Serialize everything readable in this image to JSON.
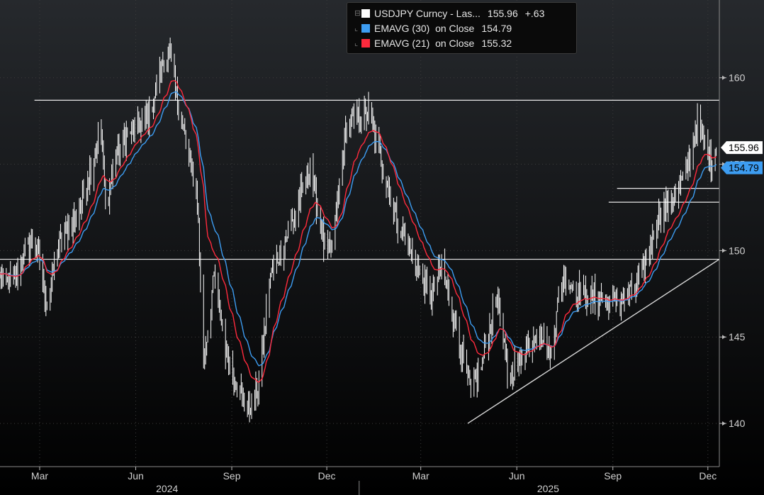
{
  "chart_data": {
    "type": "line",
    "title": "",
    "ylim": [
      137.5,
      164.5
    ],
    "y_ticks": [
      140,
      145,
      150,
      155,
      160
    ],
    "x_range": [
      "2024-01-23",
      "2025-12-12"
    ],
    "x_month_ticks": [
      {
        "label": "Mar",
        "date": "2024-03-01"
      },
      {
        "label": "Jun",
        "date": "2024-06-01"
      },
      {
        "label": "Sep",
        "date": "2024-09-01"
      },
      {
        "label": "Dec",
        "date": "2024-12-01"
      },
      {
        "label": "Mar",
        "date": "2025-03-01"
      },
      {
        "label": "Jun",
        "date": "2025-06-01"
      },
      {
        "label": "Sep",
        "date": "2025-09-01"
      },
      {
        "label": "Dec",
        "date": "2025-12-01"
      }
    ],
    "x_year_labels": [
      {
        "label": "2024",
        "date": "2024-07-01"
      },
      {
        "label": "2025",
        "date": "2025-07-01"
      }
    ],
    "series": [
      {
        "name": "USDJPY Curncy - Las...",
        "style": "hl-bars",
        "color": "#ffffff",
        "last": "155.96",
        "change": "+.63",
        "points": [
          [
            "2024-01-23",
            148.5
          ],
          [
            "2024-02-05",
            148.0
          ],
          [
            "2024-02-15",
            150.0
          ],
          [
            "2024-02-26",
            150.5
          ],
          [
            "2024-03-08",
            146.9
          ],
          [
            "2024-03-19",
            150.4
          ],
          [
            "2024-03-29",
            151.3
          ],
          [
            "2024-04-10",
            152.8
          ],
          [
            "2024-04-18",
            154.6
          ],
          [
            "2024-04-29",
            157.0
          ],
          [
            "2024-05-03",
            152.5
          ],
          [
            "2024-05-14",
            155.8
          ],
          [
            "2024-05-28",
            157.0
          ],
          [
            "2024-06-14",
            157.8
          ],
          [
            "2024-06-27",
            160.8
          ],
          [
            "2024-07-03",
            161.6
          ],
          [
            "2024-07-11",
            158.5
          ],
          [
            "2024-07-18",
            156.5
          ],
          [
            "2024-07-30",
            153.0
          ],
          [
            "2024-08-05",
            143.5
          ],
          [
            "2024-08-15",
            148.5
          ],
          [
            "2024-08-26",
            144.3
          ],
          [
            "2024-09-05",
            142.5
          ],
          [
            "2024-09-16",
            140.7
          ],
          [
            "2024-09-27",
            142.2
          ],
          [
            "2024-10-07",
            148.3
          ],
          [
            "2024-10-18",
            150.0
          ],
          [
            "2024-10-31",
            152.0
          ],
          [
            "2024-11-15",
            155.0
          ],
          [
            "2024-11-29",
            150.0
          ],
          [
            "2024-12-06",
            150.0
          ],
          [
            "2024-12-20",
            157.3
          ],
          [
            "2025-01-10",
            158.0
          ],
          [
            "2025-01-21",
            155.5
          ],
          [
            "2025-02-07",
            151.5
          ],
          [
            "2025-02-20",
            149.8
          ],
          [
            "2025-03-11",
            147.3
          ],
          [
            "2025-03-21",
            149.2
          ],
          [
            "2025-04-04",
            145.5
          ],
          [
            "2025-04-18",
            141.8
          ],
          [
            "2025-04-28",
            143.3
          ],
          [
            "2025-05-13",
            147.5
          ],
          [
            "2025-05-23",
            142.8
          ],
          [
            "2025-06-05",
            143.8
          ],
          [
            "2025-06-20",
            145.5
          ],
          [
            "2025-07-03",
            144.0
          ],
          [
            "2025-07-15",
            148.5
          ],
          [
            "2025-08-01",
            147.5
          ],
          [
            "2025-08-15",
            147.3
          ],
          [
            "2025-08-29",
            147.0
          ],
          [
            "2025-09-10",
            147.2
          ],
          [
            "2025-09-22",
            147.9
          ],
          [
            "2025-10-06",
            150.0
          ],
          [
            "2025-10-14",
            152.0
          ],
          [
            "2025-10-24",
            152.8
          ],
          [
            "2025-11-04",
            153.6
          ],
          [
            "2025-11-12",
            154.9
          ],
          [
            "2025-11-20",
            157.4
          ],
          [
            "2025-11-28",
            156.2
          ],
          [
            "2025-12-04",
            155.0
          ],
          [
            "2025-12-09",
            155.96
          ]
        ]
      },
      {
        "name": "EMAVG (30)  on Close",
        "style": "ema",
        "period": 30,
        "color": "#3d9df2",
        "last": "154.79"
      },
      {
        "name": "EMAVG (21)  on Close",
        "style": "ema",
        "period": 21,
        "color": "#ff2a3d",
        "last": "155.32"
      }
    ],
    "annotations": {
      "horizontal_lines": [
        {
          "y": 158.7,
          "from": "2024-02-25",
          "to": "2025-12-12"
        },
        {
          "y": 149.5,
          "from": "2024-01-23",
          "to": "2025-12-12"
        },
        {
          "y": 153.6,
          "from": "2025-09-05",
          "to": "2025-12-12"
        },
        {
          "y": 152.8,
          "from": "2025-08-28",
          "to": "2025-12-12"
        }
      ],
      "trend_lines": [
        {
          "x1": "2025-04-15",
          "y1": 140.0,
          "x2": "2025-12-12",
          "y2": 149.5
        }
      ]
    }
  },
  "legend": {
    "rows": [
      {
        "name": "USDJPY Curncy - Las...",
        "value": "155.96",
        "change": "+.63",
        "color": "#ffffff"
      },
      {
        "name": "EMAVG (30)  on Close",
        "value": "154.79",
        "change": "",
        "color": "#3d9df2"
      },
      {
        "name": "EMAVG (21)  on Close",
        "value": "155.32",
        "change": "",
        "color": "#ff2a3d"
      }
    ]
  },
  "price_tags": [
    {
      "text": "155.96",
      "color": "#ffffff",
      "text_color": "#000000",
      "value": 155.96
    },
    {
      "text": "154.79",
      "color": "#3d9df2",
      "text_color": "#000000",
      "value": 154.79
    }
  ],
  "colors": {
    "background_top": "#26292d",
    "background_bottom": "#000000",
    "grid": "#3c3c3c"
  }
}
